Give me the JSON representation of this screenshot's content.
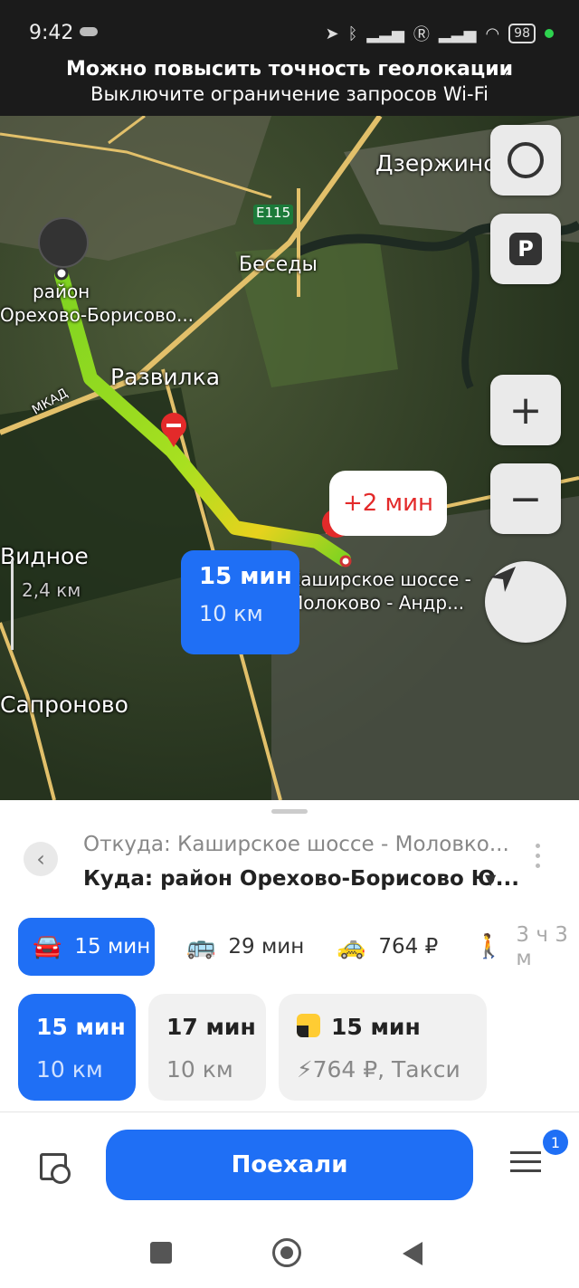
{
  "status": {
    "time": "9:42",
    "battery": "98"
  },
  "banner": {
    "title": "Можно повысить точность геолокации",
    "subtitle": "Выключите ограничение запросов Wi-Fi"
  },
  "map": {
    "labels": {
      "dzerzhinsky": "Дзержинский",
      "besedy": "Беседы",
      "e115": "E115",
      "destination_1": "район",
      "destination_2": "Орехово-Борисово...",
      "razvilka": "Развилка",
      "mkad": "МКАД",
      "vidnoe": "Видное",
      "scale": "2,4 км",
      "sapronovo": "Сапроново",
      "start_1": "Каширское шоссе -",
      "start_2": "Молоково - Андр..."
    },
    "route_card": {
      "time": "15 мин",
      "distance": "10 км"
    },
    "traffic_bubble": "+2 мин",
    "buttons": {
      "zoom_in": "+",
      "zoom_out": "−",
      "parking": "P"
    }
  },
  "route_panel": {
    "from": "Откуда: Каширское шоссе - Моловко...",
    "to": "Куда: район Орехово-Борисово Ю...",
    "modes": [
      {
        "icon": "car-icon",
        "label": "15 мин"
      },
      {
        "icon": "bus-icon",
        "label": "29 мин"
      },
      {
        "icon": "taxi-icon",
        "label": "764 ₽"
      },
      {
        "icon": "walk-icon",
        "label": "3 ч 3 м"
      }
    ],
    "options": [
      {
        "time": "15 мин",
        "detail": "10 км"
      },
      {
        "time": "17 мин",
        "detail": "10 км"
      },
      {
        "time": "15 мин",
        "detail": "764 ₽, Такси"
      }
    ],
    "go_button": "Поехали",
    "settings_badge": "1"
  },
  "colors": {
    "accent": "#1f6ff5",
    "route_green": "#7ed321",
    "route_yellow": "#e8d21d",
    "alert_red": "#e32a2a"
  }
}
